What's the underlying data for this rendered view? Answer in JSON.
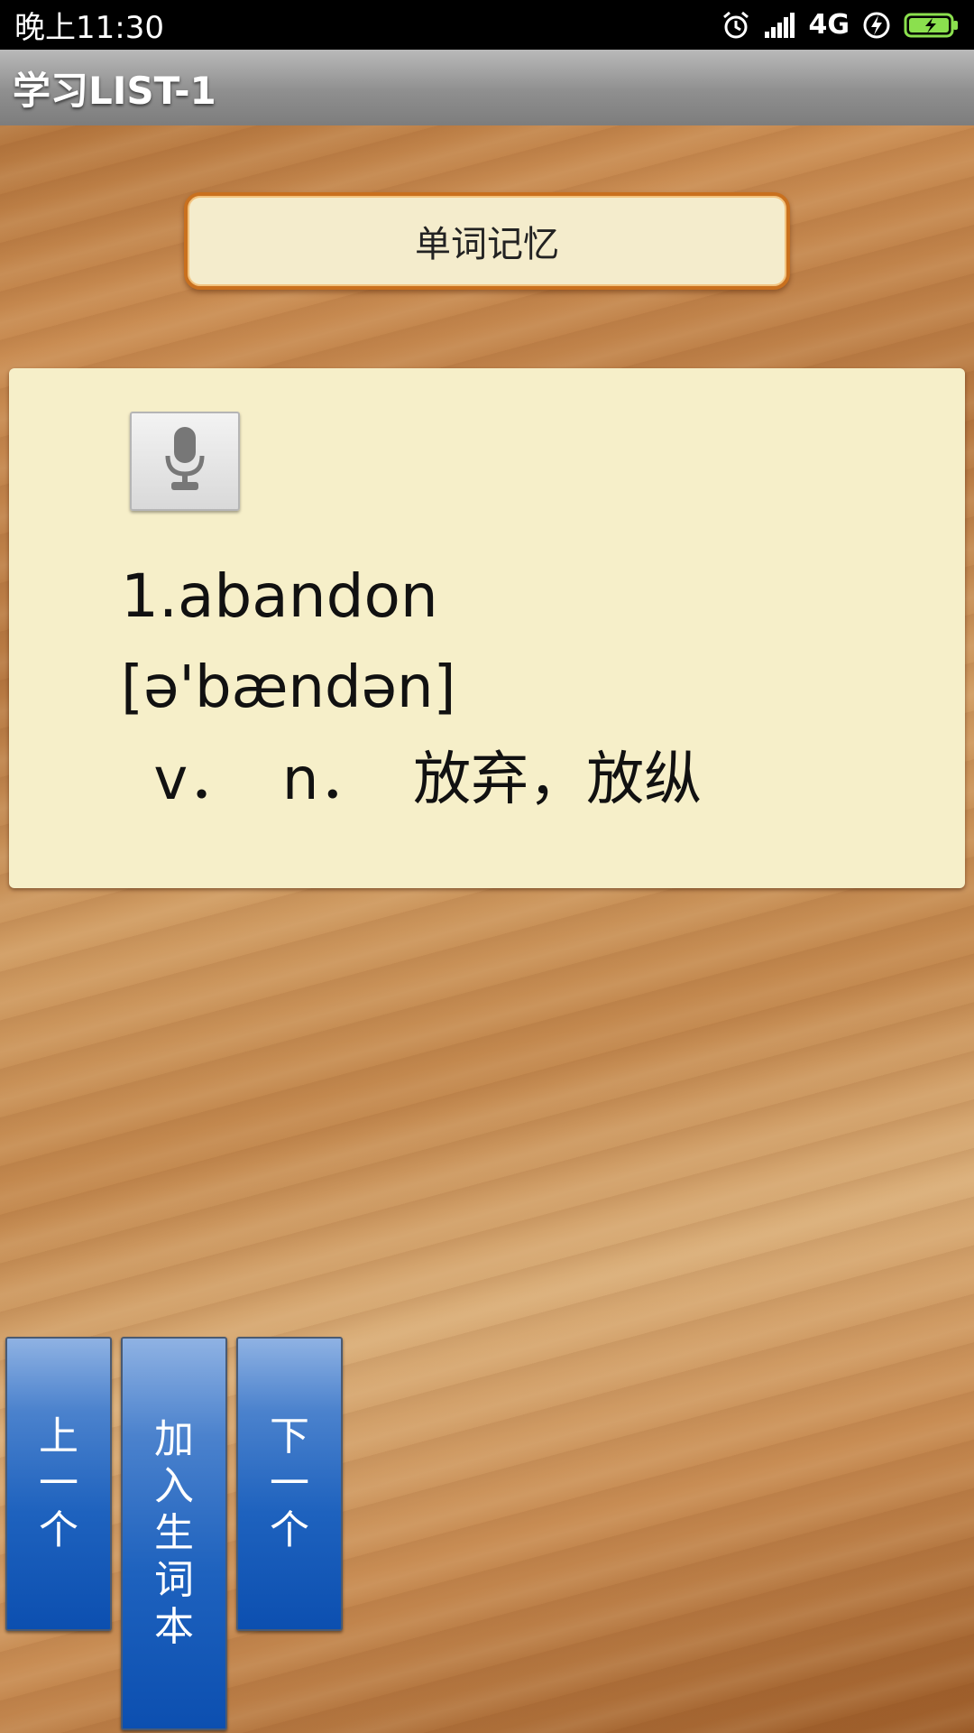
{
  "status_bar": {
    "time": "晚上11:30",
    "network": "4G",
    "icons": [
      "alarm-icon",
      "signal-icon",
      "network-4g",
      "charging-icon",
      "battery-icon"
    ]
  },
  "title_bar": {
    "title": "学习LIST-1"
  },
  "mode_button": {
    "label": "单词记忆"
  },
  "word_card": {
    "speak_icon": "microphone-icon",
    "word": "1.abandon",
    "phonetic": "[ə'bændən]",
    "meaning": " v．  n．  放弃，放纵"
  },
  "controls": {
    "prev_label": "上一个",
    "add_label": "加入生词本",
    "next_label": "下一个"
  },
  "colors": {
    "status_bar_bg": "#000000",
    "title_bar_bg": "#9a9a9a",
    "card_bg": "#f6efc9",
    "mode_button_border": "#c9701e",
    "button_blue": "#1e62be"
  }
}
